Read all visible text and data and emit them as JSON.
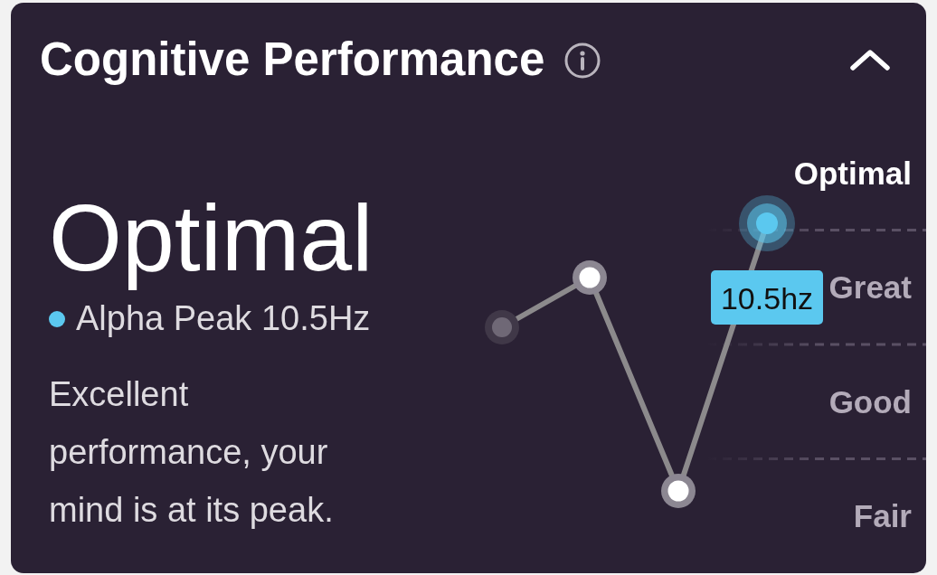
{
  "header": {
    "title": "Cognitive Performance",
    "expanded": true
  },
  "summary": {
    "rating": "Optimal",
    "metric": "Alpha Peak 10.5Hz",
    "description": "Excellent performance, your mind is at its peak."
  },
  "chart": {
    "scale": [
      {
        "label": "Optimal",
        "selected": true
      },
      {
        "label": "Great",
        "selected": false
      },
      {
        "label": "Good",
        "selected": false
      },
      {
        "label": "Fair",
        "selected": false
      }
    ],
    "reading": "10.5hz"
  }
}
